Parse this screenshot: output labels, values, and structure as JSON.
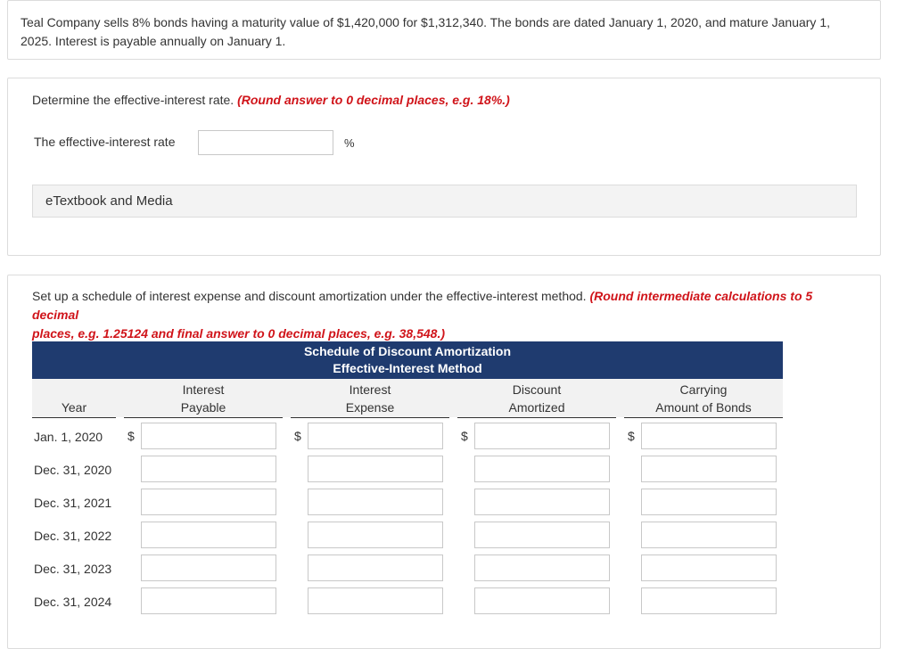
{
  "problem": {
    "intro": "Teal Company sells 8% bonds having a maturity value of $1,420,000 for $1,312,340. The bonds are dated January 1, 2020, and mature January 1, 2025. Interest is payable annually on January 1."
  },
  "part1": {
    "prompt": "Determine the effective-interest rate.",
    "instruction": "(Round answer to 0 decimal places, e.g. 18%.)",
    "field_label": "The effective-interest rate",
    "field_value": "",
    "unit": "%",
    "etextbook_label": "eTextbook and Media"
  },
  "part2": {
    "prompt": "Set up a schedule of interest expense and discount amortization under the effective-interest method.",
    "instruction_line1": "(Round intermediate calculations to 5 decimal",
    "instruction_line2": "places, e.g. 1.25124 and final answer to 0 decimal places, e.g. 38,548.)",
    "schedule_title": "Schedule of Discount Amortization",
    "schedule_subtitle": "Effective-Interest Method",
    "columns": {
      "year": "Year",
      "interest_payable_1": "Interest",
      "interest_payable_2": "Payable",
      "interest_expense_1": "Interest",
      "interest_expense_2": "Expense",
      "discount_amortized_1": "Discount",
      "discount_amortized_2": "Amortized",
      "carrying_amount_1": "Carrying",
      "carrying_amount_2": "Amount of Bonds"
    },
    "currency_symbol": "$",
    "rows": [
      {
        "label": "Jan. 1, 2020"
      },
      {
        "label": "Dec. 31, 2020"
      },
      {
        "label": "Dec. 31, 2021"
      },
      {
        "label": "Dec. 31, 2022"
      },
      {
        "label": "Dec. 31, 2023"
      },
      {
        "label": "Dec. 31, 2024"
      }
    ]
  },
  "colors": {
    "header_navy": "#1f3b6f",
    "instruction_red": "#d0141a"
  }
}
